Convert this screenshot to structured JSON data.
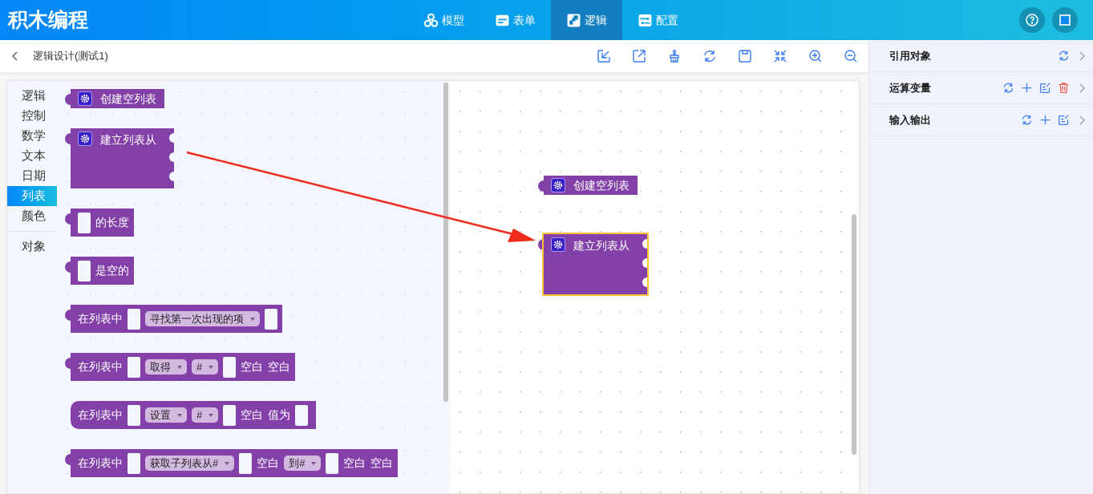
{
  "app_title": "积木编程",
  "nav_tabs": [
    {
      "label": "模型",
      "selected": false
    },
    {
      "label": "表单",
      "selected": false
    },
    {
      "label": "逻辑",
      "selected": true
    },
    {
      "label": "配置",
      "selected": false
    }
  ],
  "breadcrumb": {
    "title": "逻辑设计(测试1)"
  },
  "side_panel": {
    "sections": [
      {
        "title": "引用对象"
      },
      {
        "title": "运算变量"
      },
      {
        "title": "输入输出"
      }
    ]
  },
  "category_groups": [
    [
      {
        "label": "逻辑",
        "selected": false
      },
      {
        "label": "控制",
        "selected": false
      },
      {
        "label": "数学",
        "selected": false
      },
      {
        "label": "文本",
        "selected": false
      },
      {
        "label": "日期",
        "selected": false
      },
      {
        "label": "列表",
        "selected": true
      },
      {
        "label": "颜色",
        "selected": false
      }
    ],
    [
      {
        "label": "对象",
        "selected": false
      }
    ]
  ],
  "palette_blocks": [
    {
      "kind": "value",
      "parts": [
        {
          "kind": "gear"
        },
        {
          "kind": "label",
          "text": "创建空列表"
        }
      ]
    },
    {
      "kind": "list_builder",
      "parts": [
        {
          "kind": "gear"
        },
        {
          "kind": "label",
          "text": "建立列表从"
        }
      ]
    },
    {
      "kind": "value",
      "parts": [
        {
          "kind": "socket"
        },
        {
          "kind": "label",
          "text": "的长度"
        }
      ]
    },
    {
      "kind": "value",
      "parts": [
        {
          "kind": "socket"
        },
        {
          "kind": "label",
          "text": "是空的"
        }
      ]
    },
    {
      "kind": "value",
      "parts": [
        {
          "kind": "label",
          "text": "在列表中"
        },
        {
          "kind": "socket"
        },
        {
          "kind": "dropdown",
          "text": "寻找第一次出现的项"
        },
        {
          "kind": "socket"
        }
      ]
    },
    {
      "kind": "value",
      "parts": [
        {
          "kind": "label",
          "text": "在列表中"
        },
        {
          "kind": "socket"
        },
        {
          "kind": "dropdown",
          "text": "取得"
        },
        {
          "kind": "dropdown",
          "text": "#"
        },
        {
          "kind": "socket"
        },
        {
          "kind": "label",
          "text": "空白"
        },
        {
          "kind": "label",
          "text": "空白"
        }
      ]
    },
    {
      "kind": "statement",
      "parts": [
        {
          "kind": "label",
          "text": "在列表中"
        },
        {
          "kind": "socket"
        },
        {
          "kind": "dropdown",
          "text": "设置"
        },
        {
          "kind": "dropdown",
          "text": "#"
        },
        {
          "kind": "socket"
        },
        {
          "kind": "label",
          "text": "空白"
        },
        {
          "kind": "label",
          "text": "值为"
        },
        {
          "kind": "socket"
        }
      ]
    },
    {
      "kind": "value",
      "parts": [
        {
          "kind": "label",
          "text": "在列表中"
        },
        {
          "kind": "socket"
        },
        {
          "kind": "dropdown",
          "text": "获取子列表从#"
        },
        {
          "kind": "socket"
        },
        {
          "kind": "label",
          "text": "空白"
        },
        {
          "kind": "dropdown",
          "text": "到#"
        },
        {
          "kind": "socket"
        },
        {
          "kind": "label",
          "text": "空白"
        },
        {
          "kind": "label",
          "text": "空白"
        }
      ]
    }
  ],
  "canvas_blocks": [
    {
      "kind": "value",
      "selected": false,
      "parts": [
        {
          "kind": "gear"
        },
        {
          "kind": "label",
          "text": "创建空列表"
        }
      ]
    },
    {
      "kind": "list_builder",
      "selected": true,
      "parts": [
        {
          "kind": "gear"
        },
        {
          "kind": "label",
          "text": "建立列表从"
        }
      ]
    }
  ]
}
